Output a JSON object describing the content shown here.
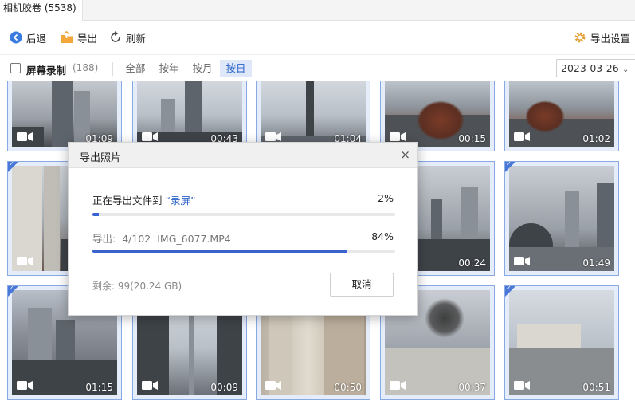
{
  "tab": {
    "title": "相机胶卷 (5538)"
  },
  "toolbar": {
    "back_label": "后退",
    "export_label": "导出",
    "refresh_label": "刷新",
    "settings_label": "导出设置",
    "accent": "#2a62c9",
    "export_icon_color": "#f3a73a",
    "settings_icon_color": "#e39a2a"
  },
  "filter": {
    "screen_record_label": "屏幕录制",
    "screen_record_count": "(188)",
    "tabs": [
      {
        "label": "全部",
        "active": false
      },
      {
        "label": "按年",
        "active": false
      },
      {
        "label": "按月",
        "active": false
      },
      {
        "label": "按日",
        "active": true
      }
    ],
    "date": "2023-03-26"
  },
  "grid": {
    "rows": [
      [
        "01:09",
        "00:43",
        "01:04",
        "00:15",
        "01:02"
      ],
      [
        "",
        "",
        "",
        "00:24",
        "01:49"
      ],
      [
        "01:15",
        "00:09",
        "00:50",
        "00:37",
        "00:51"
      ]
    ],
    "selected_marks": [
      "row2-col1",
      "row2-col5",
      "row3-col1",
      "row3-col5"
    ]
  },
  "dialog": {
    "title": "导出照片",
    "close_glyph": "×",
    "exporting_prefix": "正在导出文件到",
    "target_folder": "“录屏”",
    "overall_percent": "2%",
    "overall_progress": 0.02,
    "file_label": "导出:",
    "file_count": "4/102",
    "file_name": "IMG_6077.MP4",
    "file_percent": "84%",
    "file_progress": 0.84,
    "remaining": "剩余: 99(20.24 GB)",
    "cancel_label": "取消"
  }
}
